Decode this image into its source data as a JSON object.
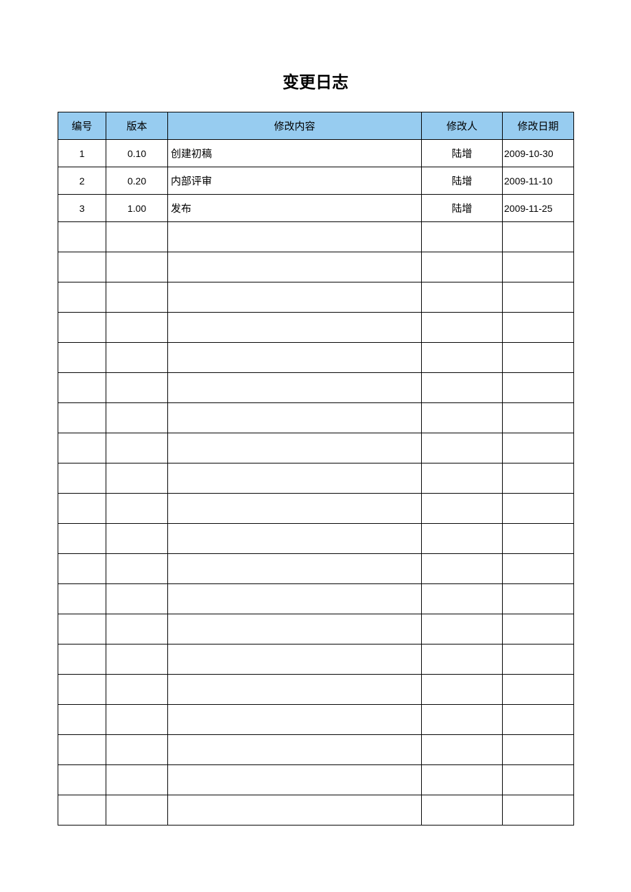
{
  "title": "变更日志",
  "headers": {
    "id": "编号",
    "version": "版本",
    "content": "修改内容",
    "author": "修改人",
    "date": "修改日期"
  },
  "rows": [
    {
      "id": "1",
      "version": "0.10",
      "content": "创建初稿",
      "author": "陆增",
      "date": "2009-10-30"
    },
    {
      "id": "2",
      "version": "0.20",
      "content": "内部评审",
      "author": "陆增",
      "date": "2009-11-10"
    },
    {
      "id": "3",
      "version": "1.00",
      "content": "发布",
      "author": "陆增",
      "date": "2009-11-25"
    }
  ],
  "empty_row_count": 20
}
